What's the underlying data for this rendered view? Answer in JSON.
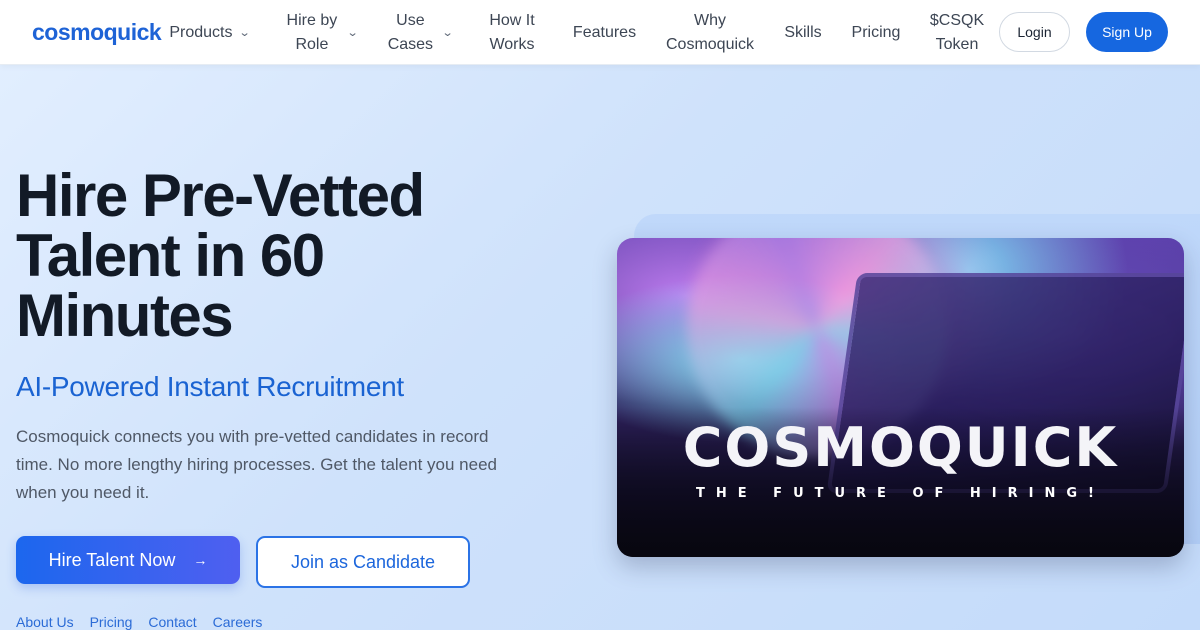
{
  "header": {
    "logo": "cosmoquick",
    "nav": [
      {
        "label": "Products",
        "has_dropdown": true
      },
      {
        "label": "Hire by Role",
        "has_dropdown": true
      },
      {
        "label": "Use Cases",
        "has_dropdown": true
      },
      {
        "label": "How It Works",
        "has_dropdown": false
      },
      {
        "label": "Features",
        "has_dropdown": false
      },
      {
        "label": "Why Cosmoquick",
        "has_dropdown": false
      },
      {
        "label": "Skills",
        "has_dropdown": false
      },
      {
        "label": "Pricing",
        "has_dropdown": false
      },
      {
        "label": "$CSQK Token",
        "has_dropdown": false
      }
    ],
    "login_label": "Login",
    "signup_label": "Sign Up"
  },
  "hero": {
    "title": "Hire Pre-Vetted Talent in 60 Minutes",
    "subtitle": "AI-Powered Instant Recruitment",
    "description": "Cosmoquick connects you with pre-vetted candidates in record time. No more lengthy hiring processes. Get the talent you need when you need it.",
    "primary_cta": "Hire Talent Now",
    "primary_cta_icon": "arrow-right-icon",
    "secondary_cta": "Join as Candidate",
    "image_title": "COSMOQUICK",
    "image_tagline": "THE FUTURE OF HIRING!"
  },
  "footer_links": [
    "About Us",
    "Pricing",
    "Contact",
    "Careers"
  ],
  "colors": {
    "brand": "#1e63d6",
    "primary_button": "#1667e0",
    "heading": "#121a26",
    "subtitle": "#1a63d2"
  }
}
